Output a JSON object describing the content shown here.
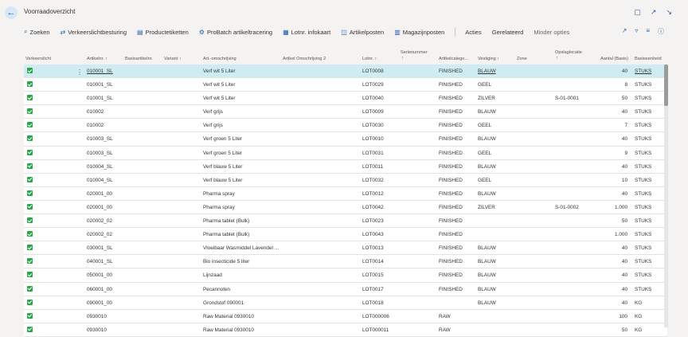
{
  "page": {
    "title": "Voorraadoverzicht"
  },
  "actions": [
    {
      "name": "search-button",
      "icon": "⌕",
      "label": "Zoeken"
    },
    {
      "name": "traffic-control-button",
      "icon": "⇄",
      "label": "Verkeerslichtbesturing"
    },
    {
      "name": "product-labels-button",
      "icon": "▤",
      "label": "Productetiketten"
    },
    {
      "name": "probatch-tracing-button",
      "icon": "⚙",
      "label": "ProBatch artikeltracering"
    },
    {
      "name": "lot-infocard-button",
      "icon": "▦",
      "label": "Lotnr. infokaart"
    },
    {
      "name": "item-entries-button",
      "icon": "◫",
      "label": "Artikelposten"
    },
    {
      "name": "warehouse-entries-button",
      "icon": "▥",
      "label": "Magazijnposten"
    }
  ],
  "menu": {
    "acties": "Acties",
    "gerelateerd": "Gerelateerd",
    "minder": "Minder opties"
  },
  "columns": {
    "verkeerslicht": "Verkeerslicht",
    "artikelnr": "Artikelnr. ↑",
    "basisartikelnr": "Basisartikelnr.",
    "variant": "Variant ↑",
    "omschrijving": "Art.-omschrijving",
    "omschrijving2": "Artikel Omschrijving 2",
    "lotnr": "Lotnr. ↑",
    "serienummer": "Serienummer",
    "serienummer_sort": "↑",
    "categorie": "Artikelcatego...",
    "vestiging": "Vestiging ↑",
    "zone": "Zone",
    "opslaglocatie": "Opslaglocatie",
    "opslaglocatie_sort": "↑",
    "aantal": "Aantal (Basis)",
    "eenheid": "Basiseenheid"
  },
  "rows": [
    {
      "art": "010001_SL",
      "desc": "Verf wit 5 Liter",
      "lot": "LOT0008",
      "cat": "FINISHED",
      "loc": "BLAUW",
      "bin": "",
      "qty": "40",
      "uom": "STUKS"
    },
    {
      "art": "010001_SL",
      "desc": "Verf wit 5 Liter",
      "lot": "LOT0029",
      "cat": "FINISHED",
      "loc": "GEEL",
      "bin": "",
      "qty": "8",
      "uom": "STUKS"
    },
    {
      "art": "010001_SL",
      "desc": "Verf wit 5 Liter",
      "lot": "LOT0040",
      "cat": "FINISHED",
      "loc": "ZILVER",
      "bin": "S-01-0001",
      "qty": "50",
      "uom": "STUKS"
    },
    {
      "art": "010002",
      "desc": "Verf grijs",
      "lot": "LOT0009",
      "cat": "FINISHED",
      "loc": "BLAUW",
      "bin": "",
      "qty": "40",
      "uom": "STUKS"
    },
    {
      "art": "010002",
      "desc": "Verf grijs",
      "lot": "LOT0030",
      "cat": "FINISHED",
      "loc": "GEEL",
      "bin": "",
      "qty": "7",
      "uom": "STUKS"
    },
    {
      "art": "010003_SL",
      "desc": "Verf groen 5 Liter",
      "lot": "LOT0010",
      "cat": "FINISHED",
      "loc": "BLAUW",
      "bin": "",
      "qty": "40",
      "uom": "STUKS"
    },
    {
      "art": "010003_SL",
      "desc": "Verf groen 5 Liter",
      "lot": "LOT0031",
      "cat": "FINISHED",
      "loc": "GEEL",
      "bin": "",
      "qty": "9",
      "uom": "STUKS"
    },
    {
      "art": "010004_SL",
      "desc": "Verf blauw 5 Liter",
      "lot": "LOT0011",
      "cat": "FINISHED",
      "loc": "BLAUW",
      "bin": "",
      "qty": "40",
      "uom": "STUKS"
    },
    {
      "art": "010004_SL",
      "desc": "Verf blauw 5 Liter",
      "lot": "LOT0032",
      "cat": "FINISHED",
      "loc": "GEEL",
      "bin": "",
      "qty": "10",
      "uom": "STUKS"
    },
    {
      "art": "020001_00",
      "desc": "Pharma spray",
      "lot": "LOT0012",
      "cat": "FINISHED",
      "loc": "BLAUW",
      "bin": "",
      "qty": "40",
      "uom": "STUKS"
    },
    {
      "art": "020001_00",
      "desc": "Pharma spray",
      "lot": "LOT0042",
      "cat": "FINISHED",
      "loc": "ZILVER",
      "bin": "S-01-0002",
      "qty": "1.000",
      "uom": "STUKS"
    },
    {
      "art": "020002_02",
      "desc": "Pharma tablet (Bulk)",
      "lot": "LOT0023",
      "cat": "FINISHED",
      "loc": "",
      "bin": "",
      "qty": "50",
      "uom": "STUKS"
    },
    {
      "art": "020002_02",
      "desc": "Pharma tablet (Bulk)",
      "lot": "LOT0043",
      "cat": "FINISHED",
      "loc": "",
      "bin": "",
      "qty": "1.000",
      "uom": "STUKS"
    },
    {
      "art": "030001_SL",
      "desc": "Vloeibaar Wasmiddel Lavendel ...",
      "lot": "LOT0013",
      "cat": "FINISHED",
      "loc": "BLAUW",
      "bin": "",
      "qty": "40",
      "uom": "STUKS"
    },
    {
      "art": "040001_SL",
      "desc": "Bio insecticide 5 liter",
      "lot": "LOT0014",
      "cat": "FINISHED",
      "loc": "BLAUW",
      "bin": "",
      "qty": "40",
      "uom": "STUKS"
    },
    {
      "art": "050001_00",
      "desc": "Lijnzaad",
      "lot": "LOT0015",
      "cat": "FINISHED",
      "loc": "BLAUW",
      "bin": "",
      "qty": "40",
      "uom": "STUKS"
    },
    {
      "art": "060001_00",
      "desc": "Pecannoten",
      "lot": "LOT0017",
      "cat": "FINISHED",
      "loc": "BLAUW",
      "bin": "",
      "qty": "40",
      "uom": "STUKS"
    },
    {
      "art": "090001_00",
      "desc": "Grondstof 090001",
      "lot": "LOT0018",
      "cat": "",
      "loc": "BLAUW",
      "bin": "",
      "qty": "40",
      "uom": "KG"
    },
    {
      "art": "0930010",
      "desc": "Raw Material 0930010",
      "lot": "LOT000006",
      "cat": "RAW",
      "loc": "",
      "bin": "",
      "qty": "100",
      "uom": "KG"
    },
    {
      "art": "0930010",
      "desc": "Raw Material 0930010",
      "lot": "LOT000011",
      "cat": "RAW",
      "loc": "",
      "bin": "",
      "qty": "50",
      "uom": "KG"
    }
  ]
}
